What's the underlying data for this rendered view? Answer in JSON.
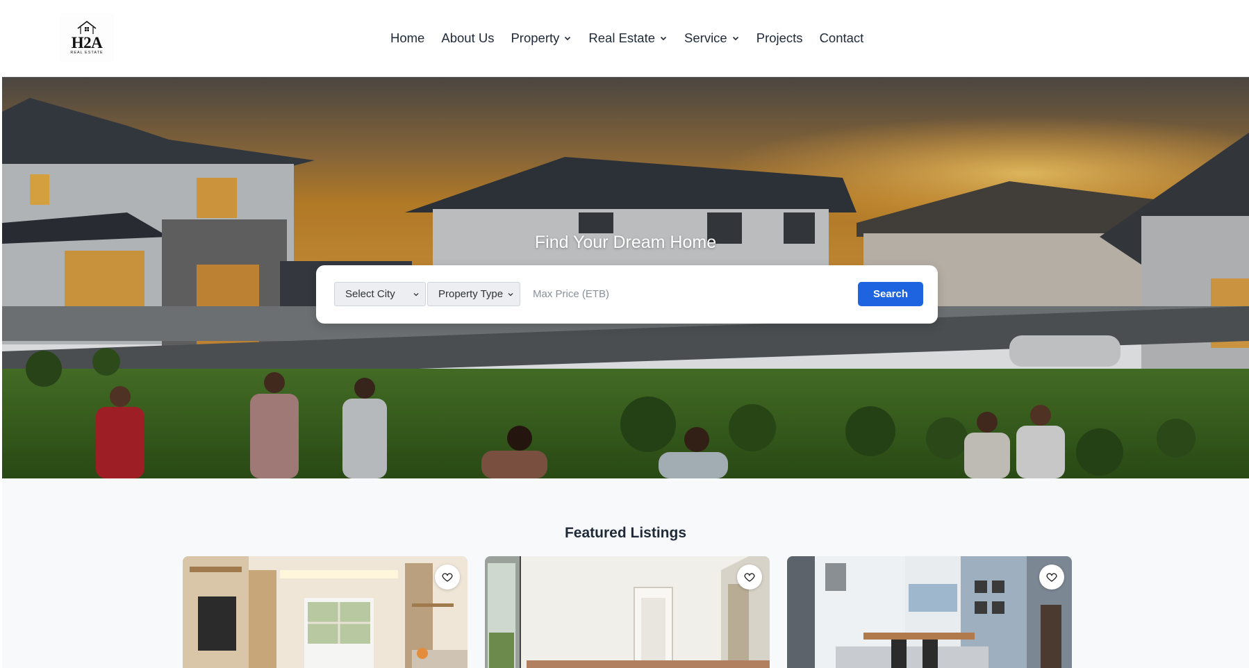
{
  "brand": {
    "logo_text": "H2A",
    "logo_subtext": "REAL ESTATE"
  },
  "nav": {
    "items": [
      {
        "label": "Home",
        "has_dropdown": false
      },
      {
        "label": "About Us",
        "has_dropdown": false
      },
      {
        "label": "Property",
        "has_dropdown": true
      },
      {
        "label": "Real Estate",
        "has_dropdown": true
      },
      {
        "label": "Service",
        "has_dropdown": true
      },
      {
        "label": "Projects",
        "has_dropdown": false
      },
      {
        "label": "Contact",
        "has_dropdown": false
      }
    ]
  },
  "hero": {
    "title": "Find Your Dream Home",
    "city_select": "Select City",
    "type_select": "Property Type",
    "price_placeholder": "Max Price (ETB)",
    "search_label": "Search"
  },
  "featured": {
    "title": "Featured Listings",
    "cards": [
      {
        "image": "living-room-photo",
        "favorite_icon": "heart-icon"
      },
      {
        "image": "empty-room-photo",
        "favorite_icon": "heart-icon"
      },
      {
        "image": "kitchen-dining-photo",
        "favorite_icon": "heart-icon"
      }
    ]
  },
  "colors": {
    "accent": "#1e63e0",
    "text": "#1f2937",
    "page_bg": "#f8f9fb"
  }
}
